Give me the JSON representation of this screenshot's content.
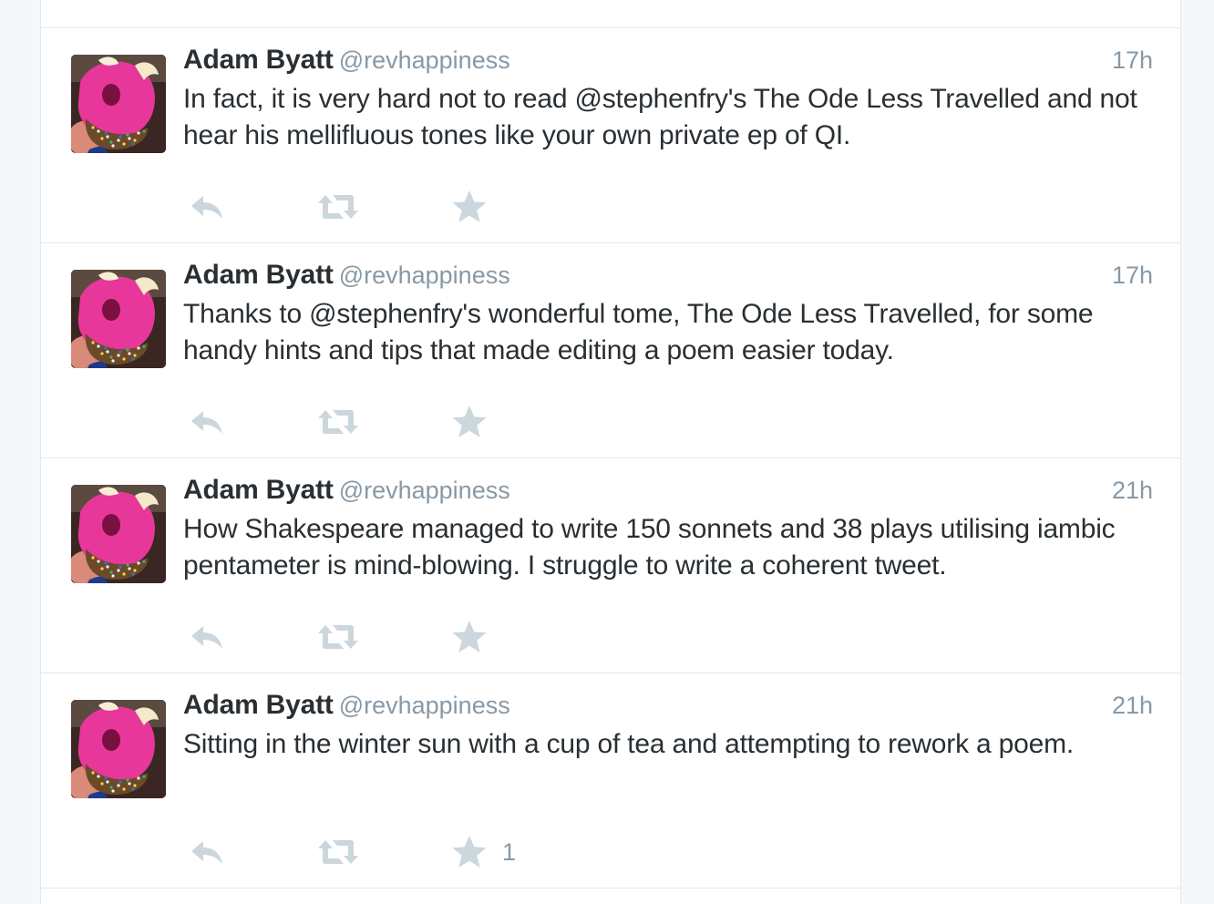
{
  "colors": {
    "name": "#292f33",
    "secondary": "#8899a6",
    "icon": "#ccd6dd",
    "divider": "#e1e8ed",
    "background": "#f5f8fa"
  },
  "icons": {
    "reply": "reply-arrow",
    "retweet": "retweet-arrows",
    "favorite": "star"
  },
  "tweets": [
    {
      "name": "Adam Byatt",
      "handle": "@revhappiness",
      "time": "17h",
      "text": "In fact, it is very hard not to read @stephenfry's The Ode Less Travelled and not hear his mellifluous tones like your own private ep of QI.",
      "favorite_count": ""
    },
    {
      "name": "Adam Byatt",
      "handle": "@revhappiness",
      "time": "17h",
      "text": "Thanks to @stephenfry's wonderful tome, The Ode Less Travelled, for some handy hints and tips that made editing a poem easier today.",
      "favorite_count": ""
    },
    {
      "name": "Adam Byatt",
      "handle": "@revhappiness",
      "time": "21h",
      "text": "How Shakespeare managed to write 150 sonnets and 38 plays utilising iambic pentameter is mind-blowing. I struggle to write a coherent tweet.",
      "favorite_count": ""
    },
    {
      "name": "Adam Byatt",
      "handle": "@revhappiness",
      "time": "21h",
      "text": "Sitting in the winter sun with a cup of tea and attempting to rework a poem.",
      "favorite_count": "1"
    }
  ]
}
